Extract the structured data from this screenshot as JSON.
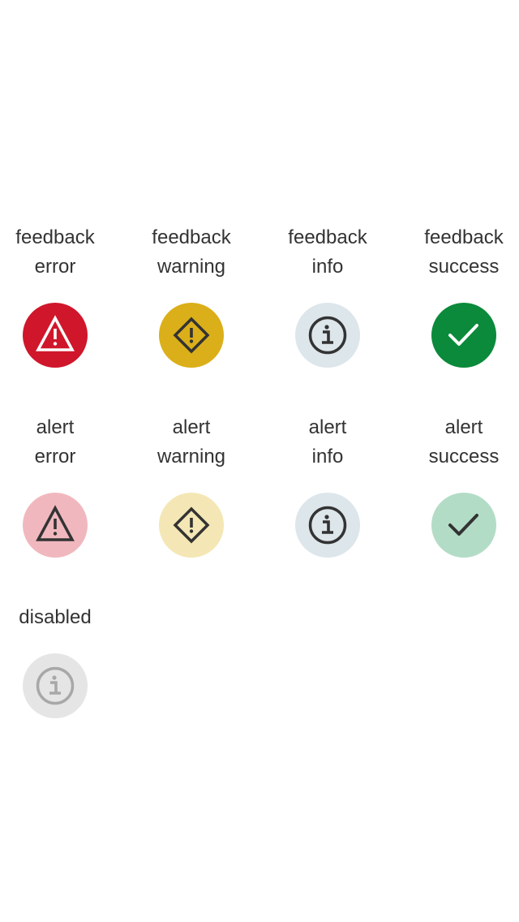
{
  "colors": {
    "feedback_error": "#d0162b",
    "feedback_warning": "#dbaf19",
    "feedback_info": "#dde6ea",
    "feedback_success": "#0a8a3a",
    "alert_error": "#f0b8be",
    "alert_warning": "#f4e7b5",
    "alert_info": "#dde6ea",
    "alert_success": "#b3dcc6",
    "disabled": "#e5e5e5",
    "icon_dark": "#333333",
    "icon_light": "#ffffff",
    "icon_disabled": "#a8a8a8"
  },
  "rows": [
    {
      "variant": "feedback",
      "items": [
        {
          "line1": "feedback",
          "line2": "error",
          "icon": "warning-triangle-icon"
        },
        {
          "line1": "feedback",
          "line2": "warning",
          "icon": "warning-diamond-icon"
        },
        {
          "line1": "feedback",
          "line2": "info",
          "icon": "info-circle-icon"
        },
        {
          "line1": "feedback",
          "line2": "success",
          "icon": "checkmark-icon"
        }
      ]
    },
    {
      "variant": "alert",
      "items": [
        {
          "line1": "alert",
          "line2": "error",
          "icon": "warning-triangle-icon"
        },
        {
          "line1": "alert",
          "line2": "warning",
          "icon": "warning-diamond-icon"
        },
        {
          "line1": "alert",
          "line2": "info",
          "icon": "info-circle-icon"
        },
        {
          "line1": "alert",
          "line2": "success",
          "icon": "checkmark-icon"
        }
      ]
    },
    {
      "variant": "disabled",
      "items": [
        {
          "line1": "disabled",
          "icon": "info-circle-icon"
        }
      ]
    }
  ]
}
